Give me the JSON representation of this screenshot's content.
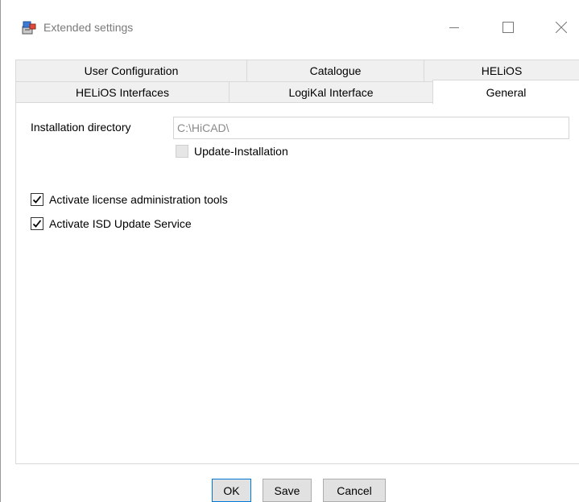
{
  "window": {
    "title": "Extended settings",
    "icons": {
      "app": "installer-app-icon",
      "minimize": "minimize-icon",
      "maximize": "maximize-icon",
      "close": "close-icon"
    }
  },
  "tabs": {
    "row1": [
      {
        "label": "User Configuration"
      },
      {
        "label": "Catalogue"
      },
      {
        "label": "HELiOS"
      }
    ],
    "row2": [
      {
        "label": "HELiOS Interfaces"
      },
      {
        "label": "LogiKal Interface"
      },
      {
        "label": "General",
        "active": true
      }
    ]
  },
  "general": {
    "install_dir_label": "Installation directory",
    "install_dir_value": "C:\\HiCAD\\",
    "update_installation_label": "Update-Installation",
    "update_installation_checked": false,
    "license_tools_label": "Activate license administration tools",
    "license_tools_checked": true,
    "isd_update_label": "Activate ISD Update Service",
    "isd_update_checked": true
  },
  "footer": {
    "ok_label": "OK",
    "save_label": "Save",
    "cancel_label": "Cancel"
  },
  "colors": {
    "tab_inactive_bg": "#f0f0f0",
    "border": "#d9d9d9",
    "button_bg": "#e1e1e1",
    "focus_border": "#0078d7"
  }
}
